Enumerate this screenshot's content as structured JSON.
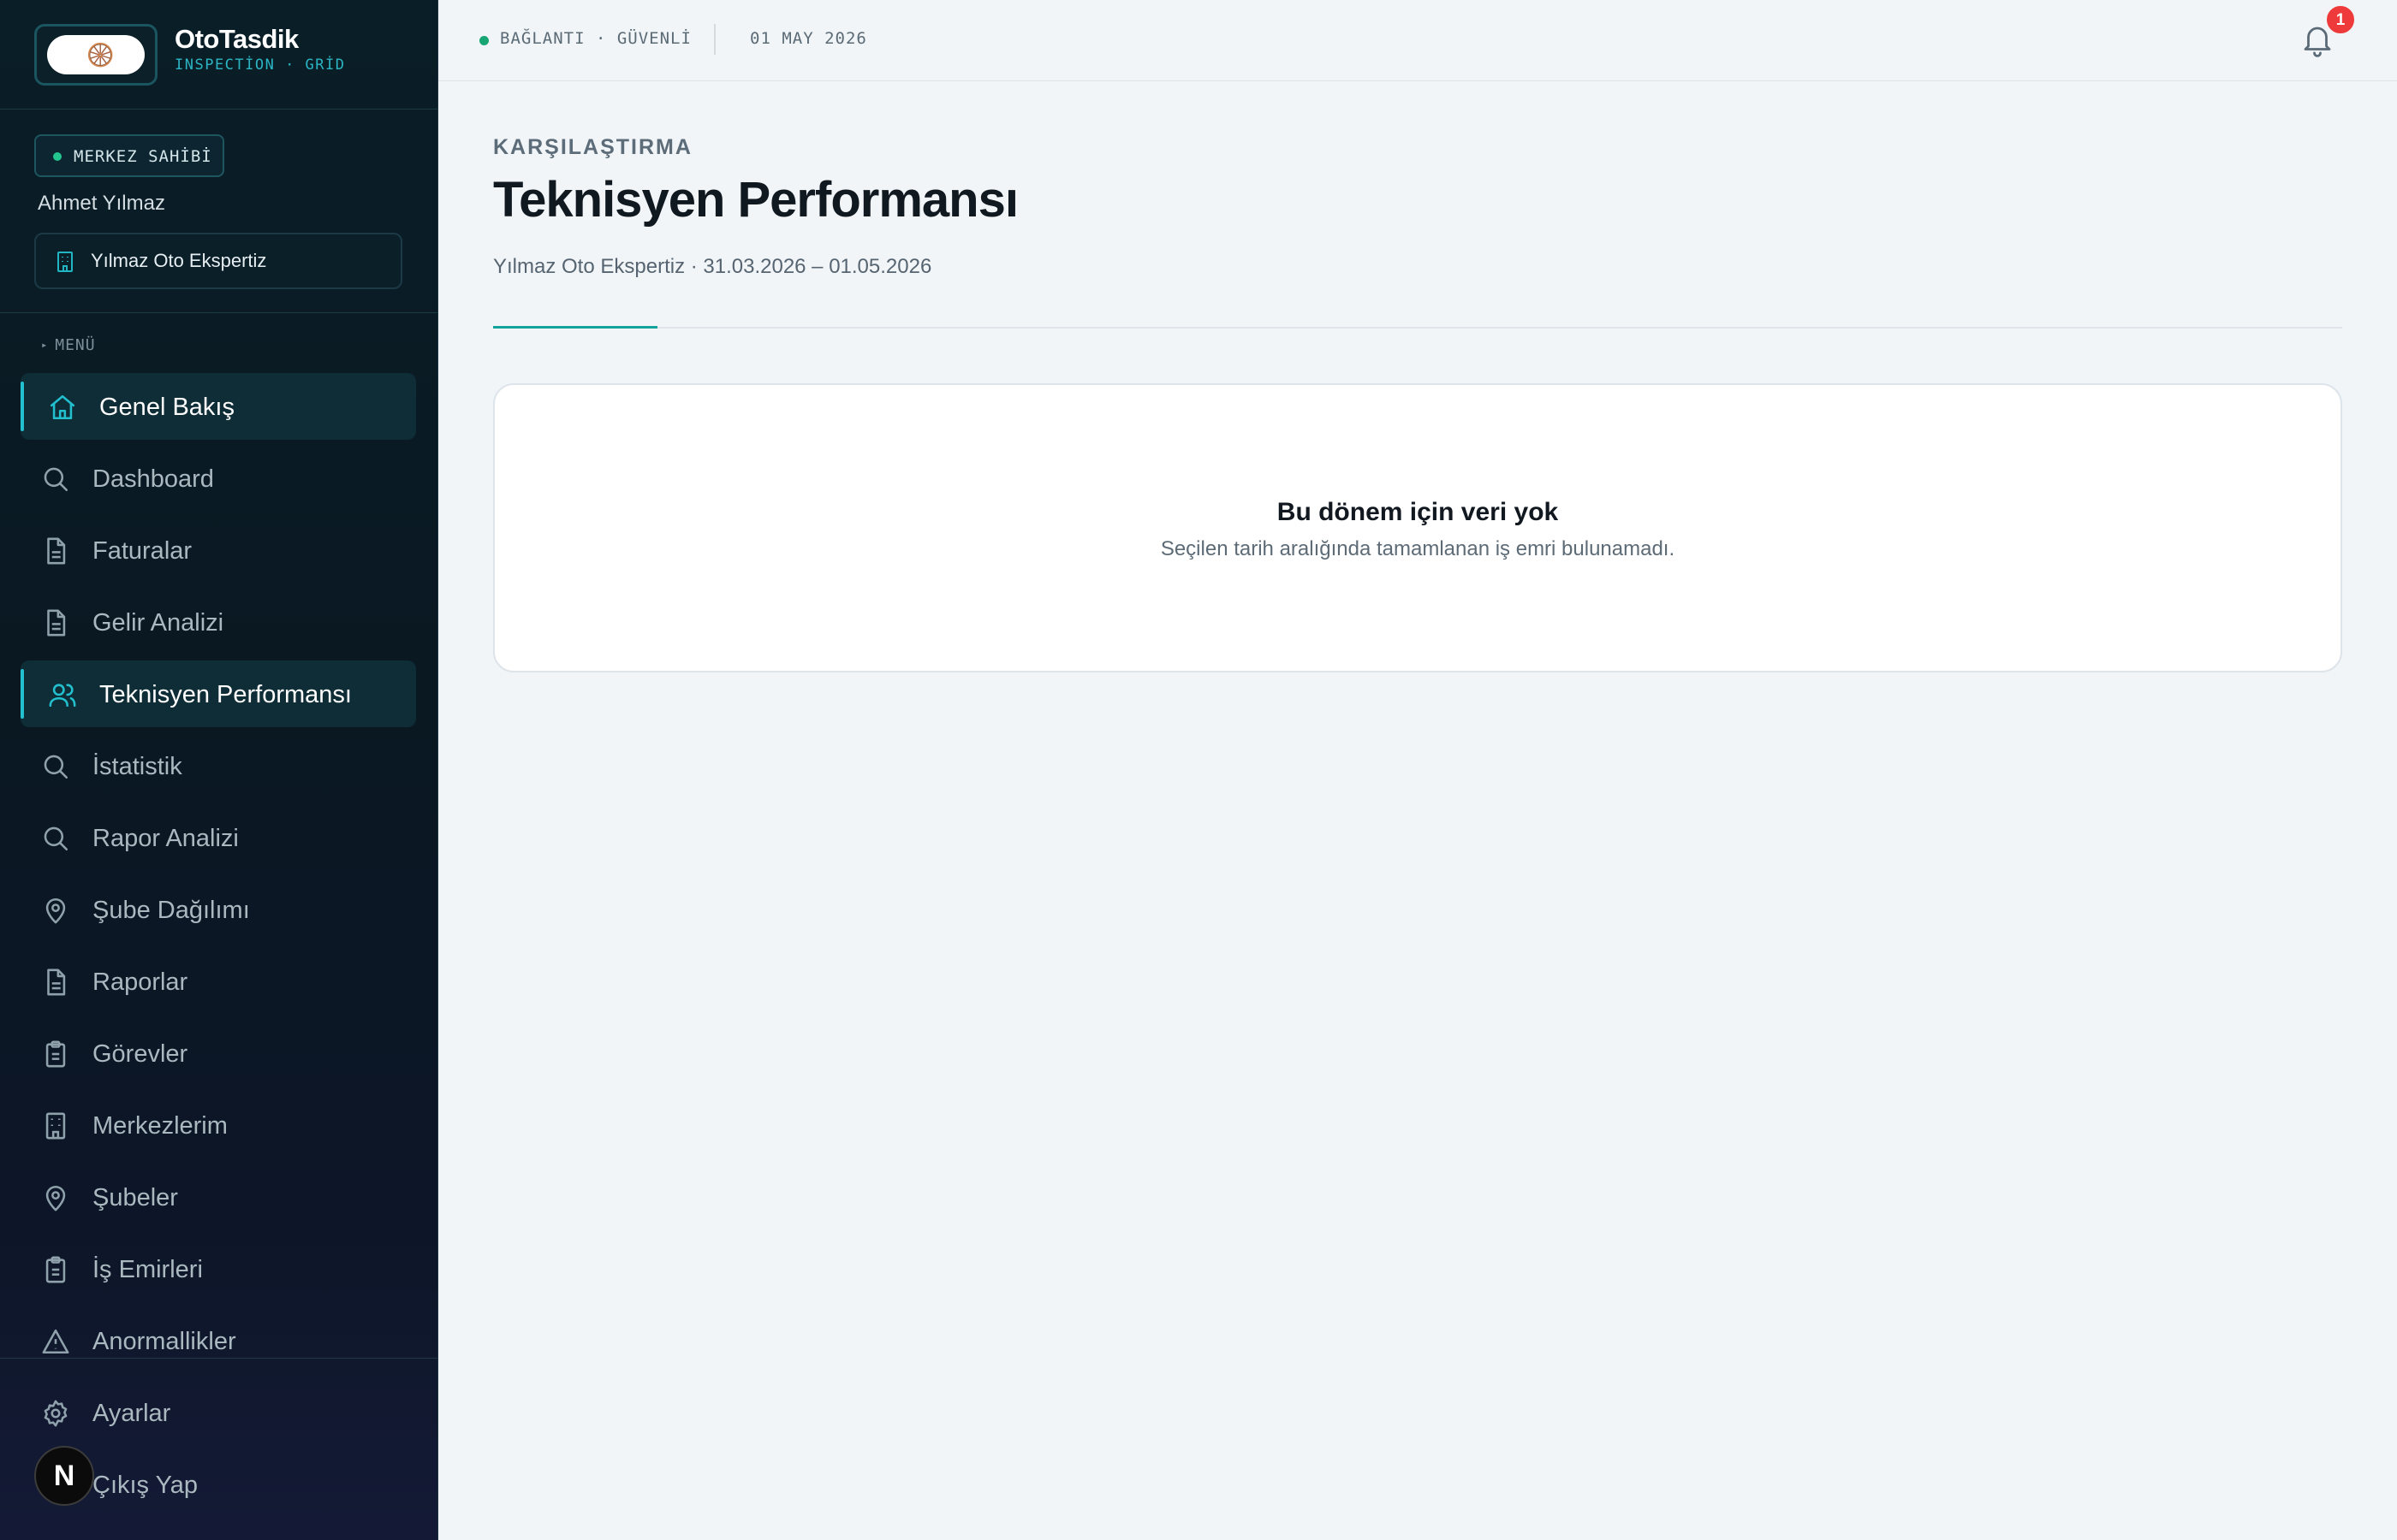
{
  "brand": {
    "name": "OtoTasdik",
    "tagline": "INSPECTİON · GRİD",
    "logo_glyph": "🛞"
  },
  "user": {
    "role": "MERKEZ SAHİBİ",
    "name": "Ahmet Yılmaz",
    "organization": "Yılmaz Oto Ekspertiz"
  },
  "sidebar": {
    "menu_label": "MENÜ",
    "items": [
      {
        "label": "Genel Bakış",
        "icon": "home-icon",
        "active": true
      },
      {
        "label": "Dashboard",
        "icon": "search-icon",
        "active": false
      },
      {
        "label": "Faturalar",
        "icon": "document-icon",
        "active": false
      },
      {
        "label": "Gelir Analizi",
        "icon": "document-icon",
        "active": false
      },
      {
        "label": "Teknisyen Performansı",
        "icon": "users-icon",
        "active": true
      },
      {
        "label": "İstatistik",
        "icon": "search-icon",
        "active": false
      },
      {
        "label": "Rapor Analizi",
        "icon": "search-icon",
        "active": false
      },
      {
        "label": "Şube Dağılımı",
        "icon": "map-pin-icon",
        "active": false
      },
      {
        "label": "Raporlar",
        "icon": "document-icon",
        "active": false
      },
      {
        "label": "Görevler",
        "icon": "clipboard-icon",
        "active": false
      },
      {
        "label": "Merkezlerim",
        "icon": "building-icon",
        "active": false
      },
      {
        "label": "Şubeler",
        "icon": "map-pin-icon",
        "active": false
      },
      {
        "label": "İş Emirleri",
        "icon": "clipboard-icon",
        "active": false
      },
      {
        "label": "Anormallikler",
        "icon": "warning-icon",
        "active": false
      }
    ],
    "footer_items": [
      {
        "label": "Ayarlar",
        "icon": "gear-icon"
      },
      {
        "label": "Çıkış Yap",
        "icon": "logout-icon"
      }
    ],
    "dev_badge": "N"
  },
  "topbar": {
    "connection": "BAĞLANTI · GÜVENLİ",
    "date": "01 MAY 2026",
    "notification_count": "1"
  },
  "page": {
    "eyebrow": "KARŞILAŞTIRMA",
    "title": "Teknisyen Performansı",
    "subtitle": "Yılmaz Oto Ekspertiz · 31.03.2026 – 01.05.2026"
  },
  "empty_state": {
    "title": "Bu dönem için veri yok",
    "message": "Seçilen tarih aralığında tamamlanan iş emri bulunamadı."
  },
  "colors": {
    "accent": "#22c0cf",
    "status_ok": "#18a574",
    "notification": "#ee3a3a",
    "sidebar_bg": "#0a1e27"
  }
}
